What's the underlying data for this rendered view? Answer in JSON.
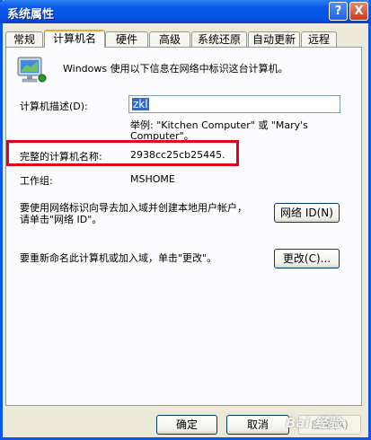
{
  "window": {
    "title": "系统属性",
    "help_button": "?",
    "close_button": "X"
  },
  "tabs": [
    {
      "label": "常规"
    },
    {
      "label": "计算机名"
    },
    {
      "label": "硬件"
    },
    {
      "label": "高级"
    },
    {
      "label": "系统还原"
    },
    {
      "label": "自动更新"
    },
    {
      "label": "远程"
    }
  ],
  "intro_text": "Windows 使用以下信息在网络中标识这台计算机。",
  "description": {
    "label": "计算机描述(D):",
    "value": "zkl",
    "example": "举例: \"Kitchen Computer\" 或 \"Mary's Computer\"。"
  },
  "full_name": {
    "label": "完整的计算机名称:",
    "value": "2938cc25cb25445."
  },
  "workgroup": {
    "label": "工作组:",
    "value": "MSHOME"
  },
  "network_id": {
    "text": "要使用网络标识向导去加入域并创建本地用户帐户，请单击\"网络 ID\"。",
    "button": "网络 ID(N)"
  },
  "rename": {
    "text": "要重新命名此计算机或加入域，单击\"更改\"。",
    "button": "更改(C)..."
  },
  "footer": {
    "ok": "确定",
    "cancel": "取消",
    "apply": "应用(A)"
  },
  "watermark": "Bai 经验",
  "colors": {
    "titlebar": "#0a58e8",
    "highlight": "#e3001b",
    "panel": "#fcfcfe"
  }
}
